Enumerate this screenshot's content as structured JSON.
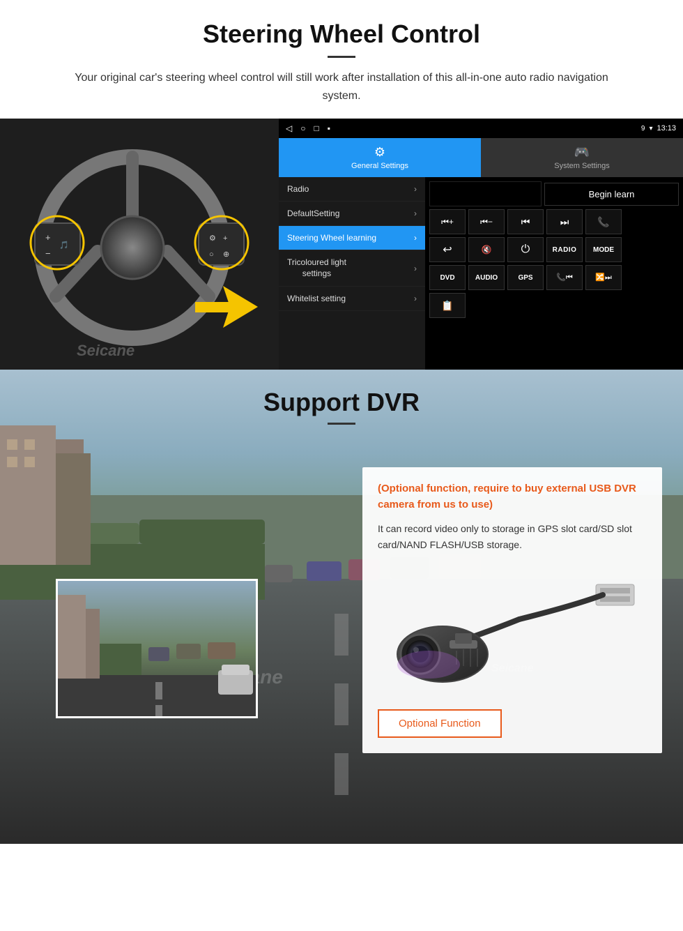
{
  "header": {
    "title": "Steering Wheel Control",
    "divider": true,
    "subtitle": "Your original car's steering wheel control will still work after installation of this all-in-one auto radio navigation system."
  },
  "android_ui": {
    "status_bar": {
      "time": "13:13",
      "signal_icon": "▼",
      "wifi_icon": "▾"
    },
    "nav_icons": [
      "◁",
      "○",
      "□",
      "▪"
    ],
    "tabs": [
      {
        "label": "General Settings",
        "icon": "⚙",
        "active": true
      },
      {
        "label": "System Settings",
        "icon": "🎮",
        "active": false
      }
    ],
    "menu_items": [
      {
        "label": "Radio",
        "active": false
      },
      {
        "label": "DefaultSetting",
        "active": false
      },
      {
        "label": "Steering Wheel learning",
        "active": true
      },
      {
        "label": "Tricoloured light settings",
        "active": false
      },
      {
        "label": "Whitelist setting",
        "active": false
      }
    ],
    "begin_learn_label": "Begin learn",
    "control_buttons_row1": [
      "⏮+",
      "⏮-",
      "⏮",
      "⏭",
      "📞"
    ],
    "control_buttons_row2": [
      "↩",
      "🔇",
      "⏻",
      "RADIO",
      "MODE"
    ],
    "control_buttons_row3": [
      "DVD",
      "AUDIO",
      "GPS",
      "📞⏮",
      "🔀⏭"
    ],
    "control_buttons_row4": [
      "📋"
    ]
  },
  "dvr_section": {
    "title": "Support DVR",
    "optional_text": "(Optional function, require to buy external USB DVR camera from us to use)",
    "description": "It can record video only to storage in GPS slot card/SD slot card/NAND FLASH/USB storage.",
    "optional_function_label": "Optional Function"
  },
  "watermark": "Seicane",
  "colors": {
    "accent_blue": "#2196F3",
    "accent_orange": "#e85a1b",
    "highlight_yellow": "#f5c400",
    "dark_bg": "#111111",
    "text_dark": "#111111"
  }
}
